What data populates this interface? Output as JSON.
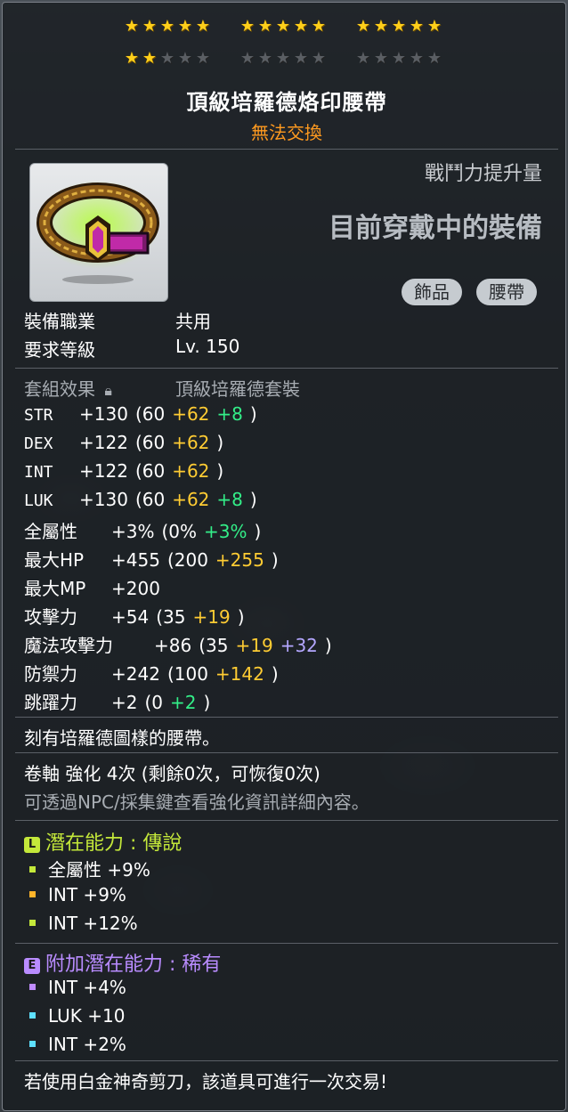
{
  "stars": {
    "row1": [
      5,
      5,
      5
    ],
    "row2_filled": 2,
    "row2": [
      5,
      5,
      5
    ]
  },
  "item": {
    "name": "頂級培羅德烙印腰帶",
    "trade_status": "無法交換",
    "power_label": "戰鬥力提升量",
    "equipped_label": "目前穿戴中的裝備",
    "tags": [
      "飾品",
      "腰帶"
    ]
  },
  "requirements": {
    "job_label": "裝備職業",
    "job_value": "共用",
    "level_label": "要求等級",
    "level_value": "Lv. 150"
  },
  "set": {
    "label": "套組效果",
    "value": "頂級培羅德套裝"
  },
  "stats": [
    {
      "name": "STR",
      "total": "+130",
      "base": "(60",
      "scroll": "+62",
      "star": "+8",
      "end": ")"
    },
    {
      "name": "DEX",
      "total": "+122",
      "base": "(60",
      "scroll": "+62",
      "star": "",
      "end": ")"
    },
    {
      "name": "INT",
      "total": "+122",
      "base": "(60",
      "scroll": "+62",
      "star": "",
      "end": ")"
    },
    {
      "name": "LUK",
      "total": "+130",
      "base": "(60",
      "scroll": "+62",
      "star": "+8",
      "end": ")"
    },
    {
      "name": "全屬性",
      "total": "+3%",
      "base": "(0%",
      "scroll": "",
      "star": "+3%",
      "end": ")"
    },
    {
      "name": "最大HP",
      "total": "+455",
      "base": "(200",
      "scroll": "+255",
      "star": "",
      "end": ")"
    },
    {
      "name": "最大MP",
      "total": "+200",
      "base": "",
      "scroll": "",
      "star": "",
      "end": ""
    },
    {
      "name": "攻擊力",
      "total": "+54",
      "base": "(35",
      "scroll": "+19",
      "star": "",
      "end": ")"
    },
    {
      "name": "魔法攻擊力",
      "total": "+86",
      "base": "(35",
      "scroll": "+19",
      "star": "+32",
      "end": ")"
    },
    {
      "name": "防禦力",
      "total": "+242",
      "base": "(100",
      "scroll": "+142",
      "star": "",
      "end": ")"
    },
    {
      "name": "跳躍力",
      "total": "+2",
      "base": "(0",
      "scroll": "",
      "star": "+2",
      "end": ")"
    }
  ],
  "description": "刻有培羅德圖樣的腰帶。",
  "enhance": {
    "line": "卷軸 強化 4次 (剩餘0次，可恢復0次)",
    "note": "可透過NPC/採集鍵查看強化資訊詳細內容。"
  },
  "potential": {
    "badge": "L",
    "title": "潛在能力 : 傳說",
    "lines": [
      "全屬性 +9%",
      "INT +9%",
      "INT +12%"
    ],
    "dot_colors": [
      "#c4e83a",
      "#ffb42a",
      "#c4e83a"
    ]
  },
  "bonus_potential": {
    "badge": "E",
    "title": "附加潛在能力 : 稀有",
    "lines": [
      "INT +4%",
      "LUK +10",
      "INT +2%"
    ],
    "dot_colors": [
      "#c08cff",
      "#5ee0ff",
      "#5ee0ff"
    ]
  },
  "footer": "若使用白金神奇剪刀，該道具可進行一次交易!",
  "colors": {
    "star_on": "#ffcf1a",
    "untradable": "#ff9a1f",
    "scroll_bonus": "#ffcc33",
    "star_bonus": "#33ee88",
    "extra_bonus": "#b4a7ff",
    "legendary": "#c4e83a",
    "rare": "#b98cff"
  }
}
